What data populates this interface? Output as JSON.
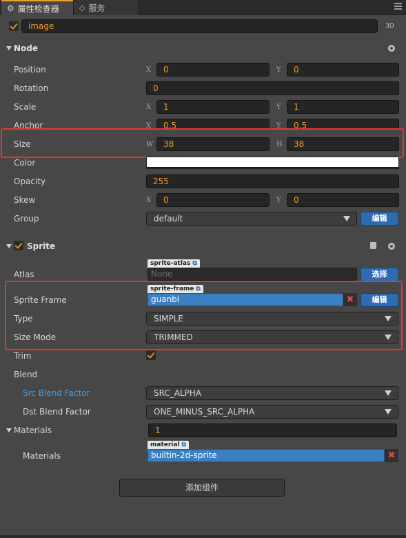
{
  "tabs": {
    "inspector_label": "属性检查器",
    "services_label": "服务"
  },
  "node_header": {
    "name": "image",
    "mode_3d": "3D"
  },
  "node": {
    "title": "Node",
    "position": {
      "label": "Position",
      "x_axis": "X",
      "x": "0",
      "y_axis": "Y",
      "y": "0"
    },
    "rotation": {
      "label": "Rotation",
      "value": "0"
    },
    "scale": {
      "label": "Scale",
      "x_axis": "X",
      "x": "1",
      "y_axis": "Y",
      "y": "1"
    },
    "anchor": {
      "label": "Anchor",
      "x_axis": "X",
      "x": "0.5",
      "y_axis": "Y",
      "y": "0.5"
    },
    "size": {
      "label": "Size",
      "w_axis": "W",
      "w": "38",
      "h_axis": "H",
      "h": "38"
    },
    "color": {
      "label": "Color",
      "value": "#ffffff"
    },
    "opacity": {
      "label": "Opacity",
      "value": "255"
    },
    "skew": {
      "label": "Skew",
      "x_axis": "X",
      "x": "0",
      "y_axis": "Y",
      "y": "0"
    },
    "group": {
      "label": "Group",
      "value": "default",
      "edit_label": "编辑"
    }
  },
  "sprite": {
    "title": "Sprite",
    "atlas": {
      "label": "Atlas",
      "tag": "sprite-atlas",
      "value": "None",
      "select_label": "选择"
    },
    "sprite_frame": {
      "label": "Sprite Frame",
      "tag": "sprite-frame",
      "value": "guanbi",
      "edit_label": "编辑"
    },
    "type": {
      "label": "Type",
      "value": "SIMPLE"
    },
    "size_mode": {
      "label": "Size Mode",
      "value": "TRIMMED"
    },
    "trim": {
      "label": "Trim",
      "checked": true
    },
    "blend": {
      "label": "Blend"
    },
    "src_blend": {
      "label": "Src Blend Factor",
      "value": "SRC_ALPHA"
    },
    "dst_blend": {
      "label": "Dst Blend Factor",
      "value": "ONE_MINUS_SRC_ALPHA"
    },
    "materials_group": {
      "label": "Materials",
      "count": "1"
    },
    "materials_item": {
      "label": "Materials",
      "tag": "material",
      "value": "builtin-2d-sprite"
    }
  },
  "add_component_label": "添加组件",
  "colors": {
    "accent_orange": "#f09a2a",
    "button_blue": "#2d6cb2",
    "asset_blue": "#3a7fc1",
    "highlight_red": "#e53530",
    "link_blue": "#3aa0e8"
  }
}
